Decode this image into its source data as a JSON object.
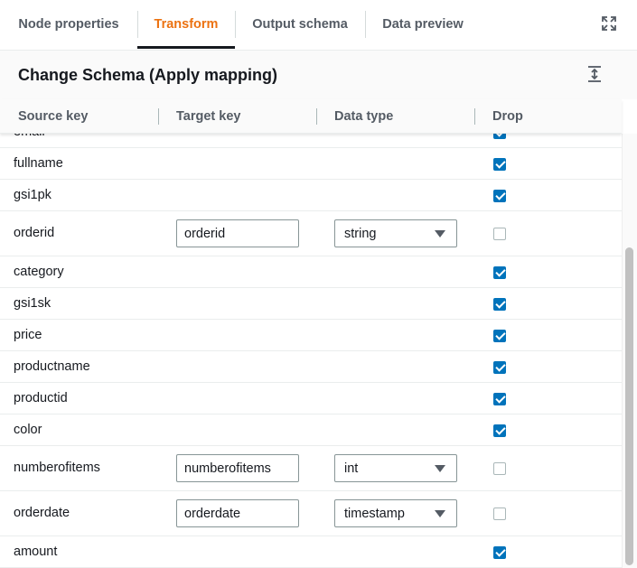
{
  "tabs": [
    {
      "label": "Node properties"
    },
    {
      "label": "Transform"
    },
    {
      "label": "Output schema"
    },
    {
      "label": "Data preview"
    }
  ],
  "active_tab": "Transform",
  "panel": {
    "title": "Change Schema (Apply mapping)"
  },
  "columns": {
    "source_key": "Source key",
    "target_key": "Target key",
    "data_type": "Data type",
    "drop": "Drop"
  },
  "rows": [
    {
      "source": "email",
      "drop": true
    },
    {
      "source": "fullname",
      "drop": true
    },
    {
      "source": "gsi1pk",
      "drop": true
    },
    {
      "source": "orderid",
      "target": "orderid",
      "type": "string",
      "drop": false
    },
    {
      "source": "category",
      "drop": true
    },
    {
      "source": "gsi1sk",
      "drop": true
    },
    {
      "source": "price",
      "drop": true
    },
    {
      "source": "productname",
      "drop": true
    },
    {
      "source": "productid",
      "drop": true
    },
    {
      "source": "color",
      "drop": true
    },
    {
      "source": "numberofitems",
      "target": "numberofitems",
      "type": "int",
      "drop": false
    },
    {
      "source": "orderdate",
      "target": "orderdate",
      "type": "timestamp",
      "drop": false
    },
    {
      "source": "amount",
      "drop": true
    }
  ],
  "colors": {
    "accent": "#ec7211",
    "checkbox": "#0073bb"
  },
  "icons": {
    "expand": "expand-icon",
    "collapse": "collapse-icon",
    "dropdown": "caret-down-icon"
  }
}
